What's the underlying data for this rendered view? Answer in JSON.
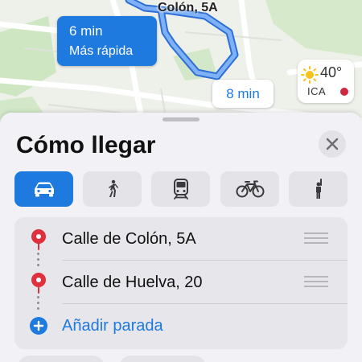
{
  "map": {
    "street_label": "Colón, 5A",
    "fast_route": {
      "time": "6 min",
      "subtitle": "Más rápida"
    },
    "alt_route": {
      "time": "8 min"
    },
    "weather": {
      "icon": "sun-icon",
      "temperature": "40°",
      "aqi_label": "ICA",
      "aqi_color": "#d3263f"
    }
  },
  "sheet": {
    "title": "Cómo llegar",
    "close_icon": "close-icon",
    "modes": [
      {
        "name": "car",
        "icon": "car-icon",
        "active": true
      },
      {
        "name": "walk",
        "icon": "walk-icon",
        "active": false
      },
      {
        "name": "transit",
        "icon": "train-icon",
        "active": false
      },
      {
        "name": "cycle",
        "icon": "bicycle-icon",
        "active": false
      },
      {
        "name": "ride",
        "icon": "person-hail-icon",
        "active": false
      }
    ],
    "stops": [
      {
        "label": "Calle de Colón, 5A",
        "icon": "pin-icon"
      },
      {
        "label": "Calle de Huelva, 20",
        "icon": "pin-icon"
      }
    ],
    "add_stop_label": "Añadir parada"
  },
  "colors": {
    "accent": "#1f7ae0",
    "route": "#4a8ff0",
    "pin": "#e0303c"
  }
}
